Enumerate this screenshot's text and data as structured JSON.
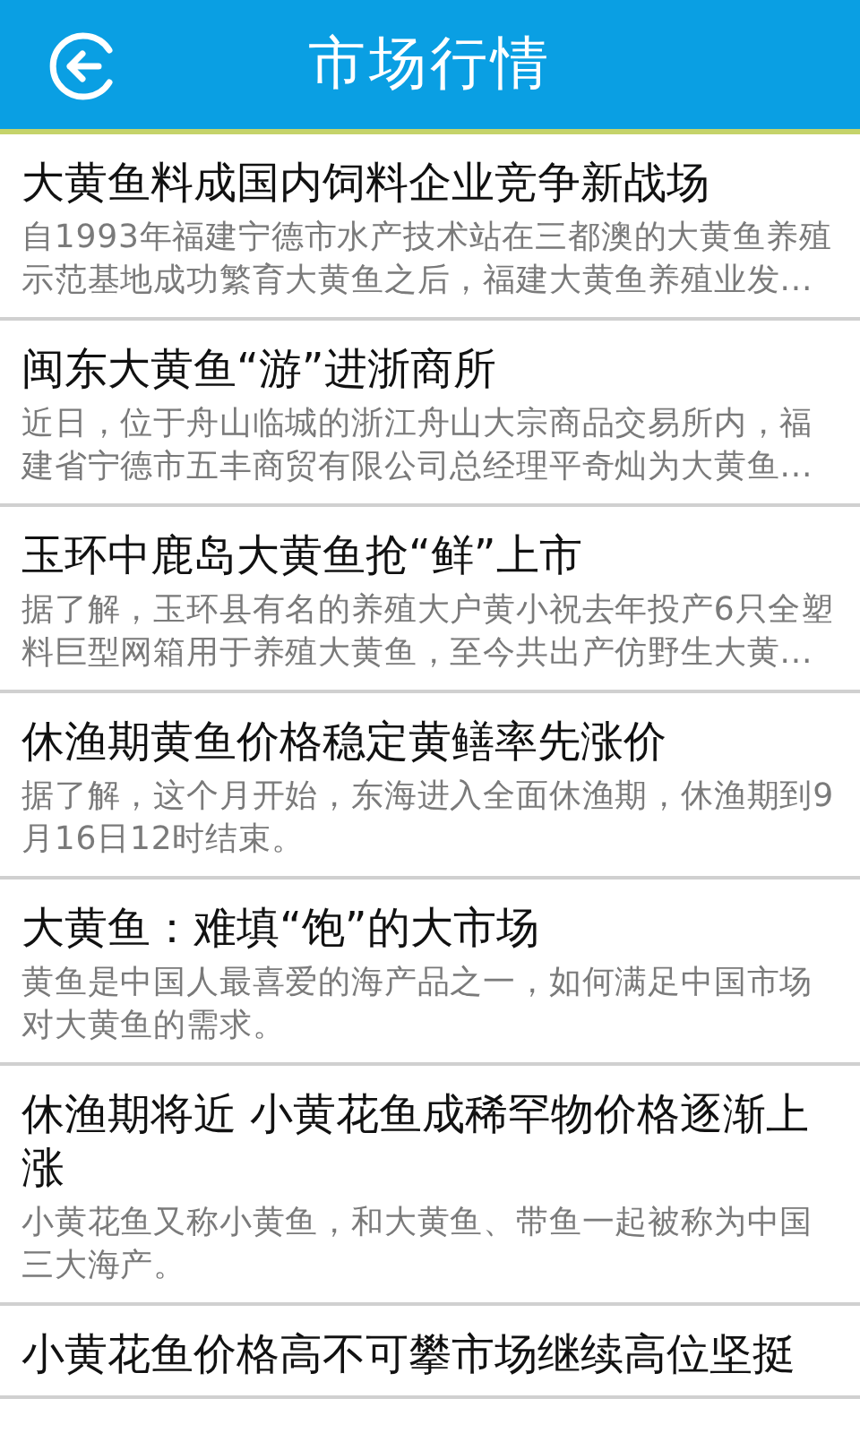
{
  "header": {
    "title": "市场行情"
  },
  "articles": [
    {
      "title": "大黄鱼料成国内饲料企业竞争新战场",
      "summary": "自1993年福建宁德市水产技术站在三都澳的大黄鱼养殖示范基地成功繁育大黄鱼之后，福建大黄鱼养殖业发..."
    },
    {
      "title": "闽东大黄鱼“游”进浙商所",
      "summary": "近日，位于舟山临城的浙江舟山大宗商品交易所内，福建省宁德市五丰商贸有限公司总经理平奇灿为大黄鱼..."
    },
    {
      "title": "玉环中鹿岛大黄鱼抢“鲜”上市",
      "summary": "据了解，玉环县有名的养殖大户黄小祝去年投产6只全塑料巨型网箱用于养殖大黄鱼，至今共出产仿野生大黄..."
    },
    {
      "title": "休渔期黄鱼价格稳定黄鳝率先涨价",
      "summary": "据了解，这个月开始，东海进入全面休渔期，休渔期到9月16日12时结束。"
    },
    {
      "title": "大黄鱼：难填“饱”的大市场",
      "summary": "黄鱼是中国人最喜爱的海产品之一，如何满足中国市场对大黄鱼的需求。"
    },
    {
      "title": "休渔期将近 小黄花鱼成稀罕物价格逐渐上涨",
      "summary": "小黄花鱼又称小黄鱼，和大黄鱼、带鱼一起被称为中国三大海产。"
    },
    {
      "title": "小黄花鱼价格高不可攀市场继续高位坚挺"
    }
  ]
}
